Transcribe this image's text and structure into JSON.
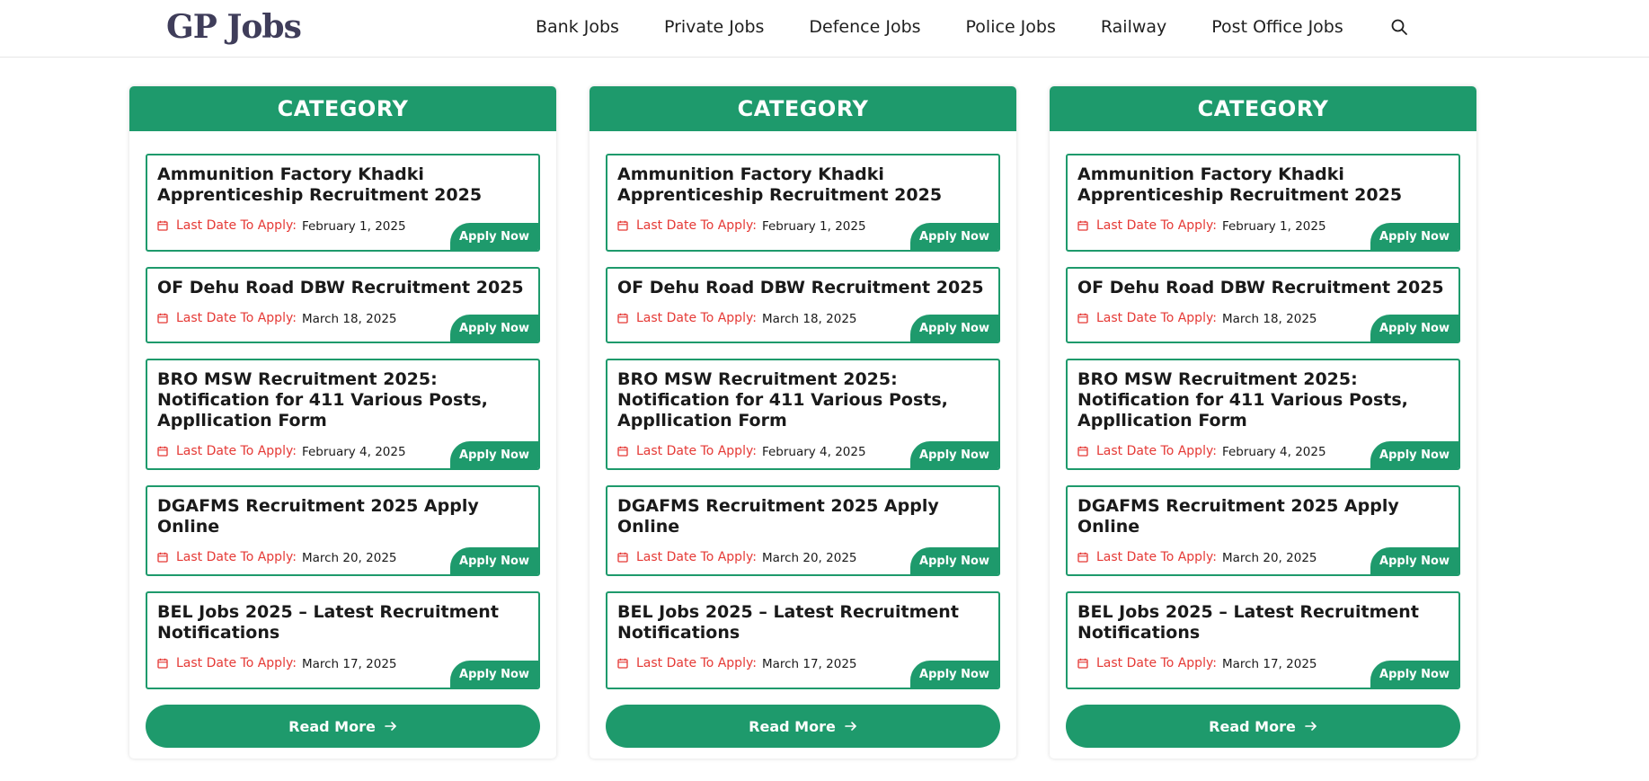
{
  "header": {
    "logo": "GP Jobs",
    "nav": [
      {
        "label": "Bank Jobs",
        "name": "nav-bank-jobs"
      },
      {
        "label": "Private Jobs",
        "name": "nav-private-jobs"
      },
      {
        "label": "Defence Jobs",
        "name": "nav-defence-jobs"
      },
      {
        "label": "Police Jobs",
        "name": "nav-police-jobs"
      },
      {
        "label": "Railway",
        "name": "nav-railway"
      },
      {
        "label": "Post Office Jobs",
        "name": "nav-post-office-jobs"
      }
    ],
    "search_icon": "search-icon"
  },
  "columns": [
    {
      "heading": "CATEGORY",
      "read_more": "Read More",
      "jobs": [
        {
          "title": "Ammunition Factory Khadki Apprenticeship Recruitment 2025",
          "date_label": "Last Date To Apply:",
          "date": "February 1, 2025",
          "apply": "Apply Now"
        },
        {
          "title": "OF Dehu Road DBW Recruitment 2025",
          "date_label": "Last Date To Apply:",
          "date": "March 18, 2025",
          "apply": "Apply Now"
        },
        {
          "title": "BRO MSW Recruitment 2025: Notification for 411 Various Posts, Appllication Form",
          "date_label": "Last Date To Apply:",
          "date": "February 4, 2025",
          "apply": "Apply Now"
        },
        {
          "title": "DGAFMS Recruitment 2025 Apply Online",
          "date_label": "Last Date To Apply:",
          "date": "March 20, 2025",
          "apply": "Apply Now"
        },
        {
          "title": "BEL Jobs 2025 – Latest Recruitment Notifications",
          "date_label": "Last Date To Apply:",
          "date": "March 17, 2025",
          "apply": "Apply Now"
        }
      ]
    },
    {
      "heading": "CATEGORY",
      "read_more": "Read More",
      "jobs": [
        {
          "title": "Ammunition Factory Khadki Apprenticeship Recruitment 2025",
          "date_label": "Last Date To Apply:",
          "date": "February 1, 2025",
          "apply": "Apply Now"
        },
        {
          "title": "OF Dehu Road DBW Recruitment 2025",
          "date_label": "Last Date To Apply:",
          "date": "March 18, 2025",
          "apply": "Apply Now"
        },
        {
          "title": "BRO MSW Recruitment 2025: Notification for 411 Various Posts, Appllication Form",
          "date_label": "Last Date To Apply:",
          "date": "February 4, 2025",
          "apply": "Apply Now"
        },
        {
          "title": "DGAFMS Recruitment 2025 Apply Online",
          "date_label": "Last Date To Apply:",
          "date": "March 20, 2025",
          "apply": "Apply Now"
        },
        {
          "title": "BEL Jobs 2025 – Latest Recruitment Notifications",
          "date_label": "Last Date To Apply:",
          "date": "March 17, 2025",
          "apply": "Apply Now"
        }
      ]
    },
    {
      "heading": "CATEGORY",
      "read_more": "Read More",
      "jobs": [
        {
          "title": "Ammunition Factory Khadki Apprenticeship Recruitment 2025",
          "date_label": "Last Date To Apply:",
          "date": "February 1, 2025",
          "apply": "Apply Now"
        },
        {
          "title": "OF Dehu Road DBW Recruitment 2025",
          "date_label": "Last Date To Apply:",
          "date": "March 18, 2025",
          "apply": "Apply Now"
        },
        {
          "title": "BRO MSW Recruitment 2025: Notification for 411 Various Posts, Appllication Form",
          "date_label": "Last Date To Apply:",
          "date": "February 4, 2025",
          "apply": "Apply Now"
        },
        {
          "title": "DGAFMS Recruitment 2025 Apply Online",
          "date_label": "Last Date To Apply:",
          "date": "March 20, 2025",
          "apply": "Apply Now"
        },
        {
          "title": "BEL Jobs 2025 – Latest Recruitment Notifications",
          "date_label": "Last Date To Apply:",
          "date": "March 17, 2025",
          "apply": "Apply Now"
        }
      ]
    }
  ],
  "colors": {
    "accent": "#1e9a6c",
    "date_label": "#e53935",
    "logo": "#3f3d5a"
  }
}
